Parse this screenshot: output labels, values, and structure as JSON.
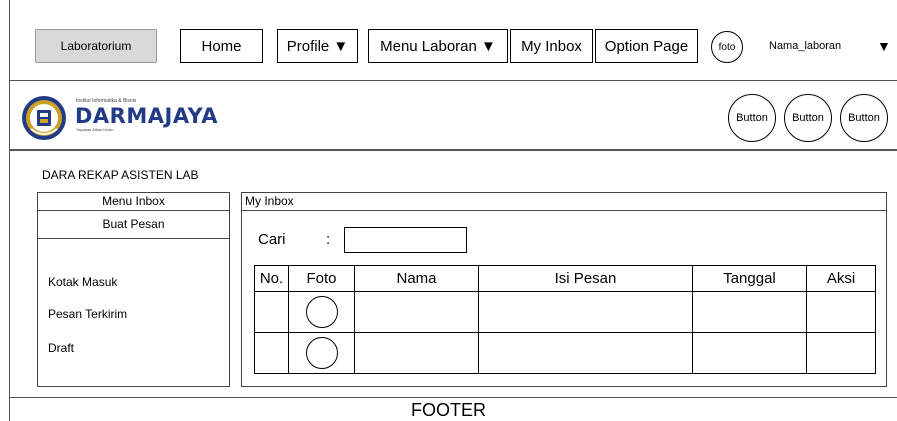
{
  "nav": {
    "lab_label": "Laboratorium",
    "home_label": "Home",
    "profile_label": "Profile ▼",
    "menu_laboran_label": "Menu Laboran ▼",
    "my_inbox_label": "My Inbox",
    "option_page_label": "Option Page",
    "foto_label": "foto",
    "user_name": "Nama_laboran",
    "user_caret": "▼"
  },
  "header": {
    "logo_small_text": "Institut Informatika & Bisnis",
    "logo_name": "DARMAJAYA",
    "logo_sub_text": "Yayasan Alfian Husin",
    "buttons": [
      "Button",
      "Button",
      "Button"
    ]
  },
  "content": {
    "page_title": "DARA REKAP ASISTEN LAB",
    "sidebar": {
      "header": "Menu Inbox",
      "compose": "Buat Pesan",
      "links": [
        "Kotak Masuk",
        "Pesan Terkirim",
        "Draft"
      ]
    },
    "panel": {
      "title": "My Inbox",
      "search_label": "Cari",
      "search_colon": ":",
      "search_value": "",
      "columns": [
        "No.",
        "Foto",
        "Nama",
        "Isi Pesan",
        "Tanggal",
        "Aksi"
      ],
      "row_count": 2
    }
  },
  "footer": {
    "label": "FOOTER"
  },
  "colors": {
    "nav_lab_bg": "#d9d9d9",
    "logo_blue": "#233b87",
    "logo_gold": "#c9a227"
  }
}
